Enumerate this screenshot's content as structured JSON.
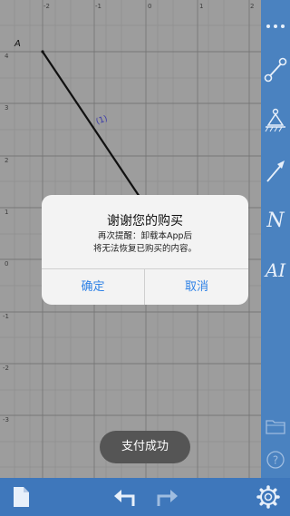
{
  "canvas": {
    "x_ticks": [
      "-2",
      "-1",
      "0",
      "1",
      "2"
    ],
    "y_ticks": [
      "4",
      "3",
      "2",
      "1",
      "0",
      "-1",
      "-2",
      "-3"
    ],
    "point_label": "A",
    "segment_label": "(1)"
  },
  "sidebar": {
    "items": [
      {
        "name": "more-menu",
        "icon": "ellipsis-icon"
      },
      {
        "name": "segment-tool",
        "icon": "segment-icon"
      },
      {
        "name": "force-tool",
        "icon": "support-icon"
      },
      {
        "name": "vector-tool",
        "icon": "arrow-icon"
      },
      {
        "name": "normal-tool",
        "label": "N"
      },
      {
        "name": "ai-tool",
        "label": "AI"
      },
      {
        "name": "folder",
        "icon": "folder-icon"
      },
      {
        "name": "help",
        "icon": "question-icon"
      }
    ]
  },
  "bottombar": {
    "items": [
      "new-file-icon",
      "undo-icon",
      "redo-icon",
      "settings-icon"
    ]
  },
  "dialog": {
    "title": "谢谢您的购买",
    "message_line1": "再次提醒：卸载本App后",
    "message_line2": "将无法恢复已购买的内容。",
    "confirm_label": "确定",
    "cancel_label": "取消"
  },
  "toast": {
    "text": "支付成功"
  },
  "colors": {
    "accent": "#2f82e6",
    "sidebar": "#4a82c0",
    "bottombar": "#3e77bb"
  }
}
